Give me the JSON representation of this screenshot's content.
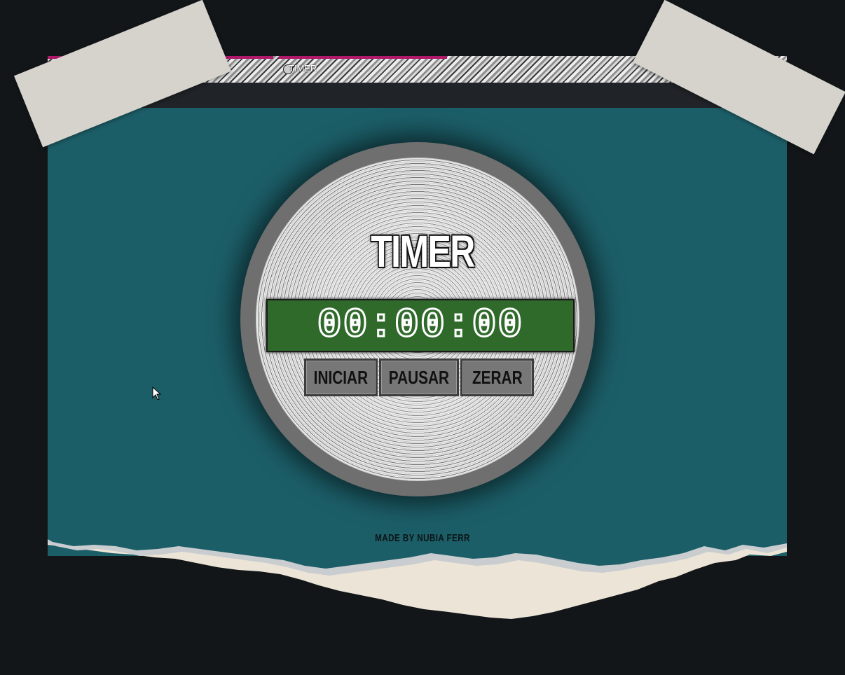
{
  "browser": {
    "tab_left_label": "e",
    "tab_active_label": "TIMER",
    "address": ""
  },
  "timer": {
    "title": "TIMER",
    "display": "00:00:00",
    "buttons": {
      "start": "INICIAR",
      "pause": "PAUSAR",
      "reset": "ZERAR"
    }
  },
  "footer": {
    "credit": "MADE BY NUBIA FERR"
  },
  "colors": {
    "page_background": "#1c5e68",
    "outer_background": "#121619",
    "display_background": "#2f6a2b",
    "button_background": "#777777",
    "tab_accent": "#b0186a"
  },
  "icons": [
    "mouse-cursor-icon",
    "tab-favicon-icon"
  ]
}
